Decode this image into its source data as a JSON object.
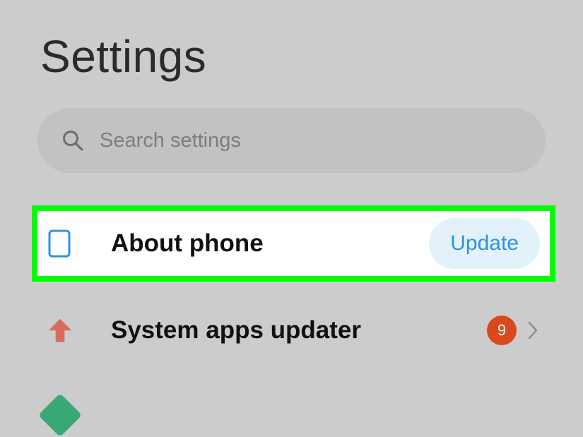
{
  "header": {
    "title": "Settings"
  },
  "search": {
    "placeholder": "Search settings",
    "icon": "search-icon"
  },
  "settings_list": [
    {
      "label": "About phone",
      "icon": "phone-outline-icon",
      "action_label": "Update",
      "highlighted": true,
      "colors": {
        "icon": "#2f93db",
        "action_text": "#2f93db",
        "action_bg": "#e3f1fb",
        "highlight_border": "#00ff00"
      }
    },
    {
      "label": "System apps updater",
      "icon": "arrow-up-icon",
      "badge_count": "9",
      "trailing_icon": "chevron-right-icon",
      "colors": {
        "icon": "#d96a5e",
        "badge_bg": "#d8491e"
      }
    },
    {
      "label": "",
      "icon": "shield-icon",
      "colors": {
        "icon": "#3aa876"
      }
    }
  ],
  "theme": {
    "background": "#cccccc",
    "search_bg": "#c2c2c2"
  }
}
